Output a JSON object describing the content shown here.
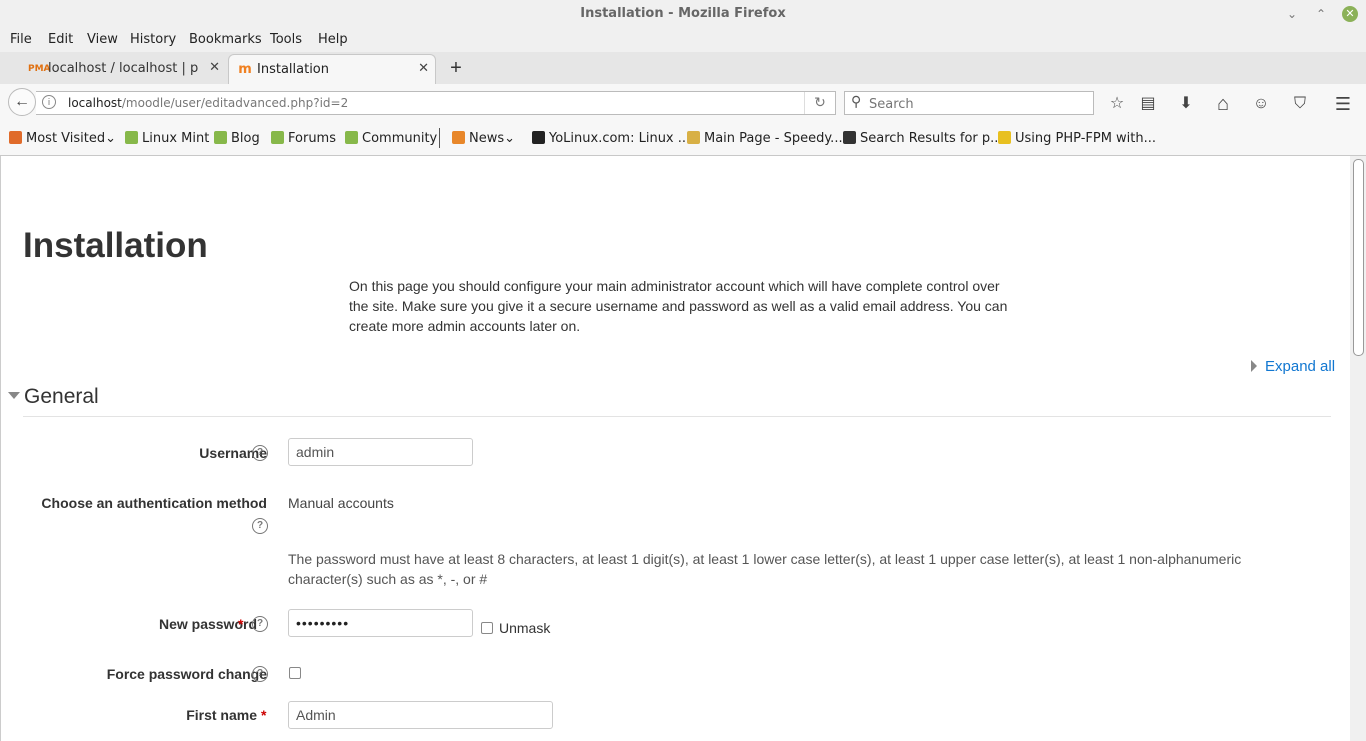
{
  "window": {
    "title": "Installation - Mozilla Firefox",
    "minimize": "⌄",
    "maximize": "⌃",
    "close": "✕"
  },
  "menu": [
    "File",
    "Edit",
    "View",
    "History",
    "Bookmarks",
    "Tools",
    "Help"
  ],
  "tabs": [
    {
      "label": "localhost / localhost | ph...",
      "favicon": "PMA",
      "close": "✕"
    },
    {
      "label": "Installation",
      "favicon": "m",
      "close": "✕"
    }
  ],
  "new_tab": "+",
  "nav": {
    "back": "←",
    "url_host": "localhost",
    "url_path": "/moodle/user/editadvanced.php?id=2",
    "info": "i",
    "reload": "↻",
    "search_placeholder": "Search",
    "search_icon": "🔍"
  },
  "toolbar_icons": [
    {
      "name": "bookmark-star-icon",
      "glyph": "☆"
    },
    {
      "name": "reading-list-icon",
      "glyph": "▤"
    },
    {
      "name": "downloads-icon",
      "glyph": "⬇"
    },
    {
      "name": "home-icon",
      "glyph": "⌂"
    },
    {
      "name": "hello-icon",
      "glyph": "☺"
    },
    {
      "name": "pocket-icon",
      "glyph": "⛉"
    },
    {
      "name": "hamburger-menu-icon",
      "glyph": "☰"
    }
  ],
  "bookmarks": [
    {
      "label": "Most Visited",
      "icon": "most-visited-icon",
      "color": "#e06b2a",
      "dropdown": "⌄"
    },
    {
      "label": "Linux Mint",
      "icon": "mint-icon",
      "color": "#87b84a"
    },
    {
      "label": "Blog",
      "icon": "mint-icon",
      "color": "#87b84a"
    },
    {
      "label": "Forums",
      "icon": "mint-icon",
      "color": "#87b84a"
    },
    {
      "label": "Community",
      "icon": "mint-icon",
      "color": "#87b84a"
    },
    {
      "label": "News",
      "icon": "rss-icon",
      "color": "#e8872a",
      "dropdown": "⌄"
    },
    {
      "label": "YoLinux.com: Linux ...",
      "icon": "tux-icon",
      "color": "#222222"
    },
    {
      "label": "Main Page - Speedy...",
      "icon": "speedy-icon",
      "color": "#d8b045"
    },
    {
      "label": "Search Results for p...",
      "icon": "codepen-icon",
      "color": "#333333"
    },
    {
      "label": "Using PHP-FPM with...",
      "icon": "lightbulb-icon",
      "color": "#e8c020"
    }
  ],
  "page": {
    "title": "Installation",
    "intro": "On this page you should configure your main administrator account which will have complete control over the site. Make sure you give it a secure username and password as well as a valid email address. You can create more admin accounts later on.",
    "expand_all": "Expand all",
    "section": "General",
    "help_glyph": "?",
    "required_mark": "*",
    "fields": {
      "username": {
        "label": "Username",
        "value": "admin"
      },
      "auth": {
        "label": "Choose an authentication method",
        "value": "Manual accounts"
      },
      "password_note": "The password must have at least 8 characters, at least 1 digit(s), at least 1 lower case letter(s), at least 1 upper case letter(s), at least 1 non-alphanumeric character(s) such as as *, -, or #",
      "new_password": {
        "label": "New password",
        "value": "•••••••••",
        "unmask": "Unmask"
      },
      "force_change": {
        "label": "Force password change"
      },
      "first_name": {
        "label": "First name",
        "value": "Admin"
      }
    }
  },
  "colors": {
    "link": "#1177d1",
    "required": "#cc0000",
    "heading": "#333333"
  }
}
